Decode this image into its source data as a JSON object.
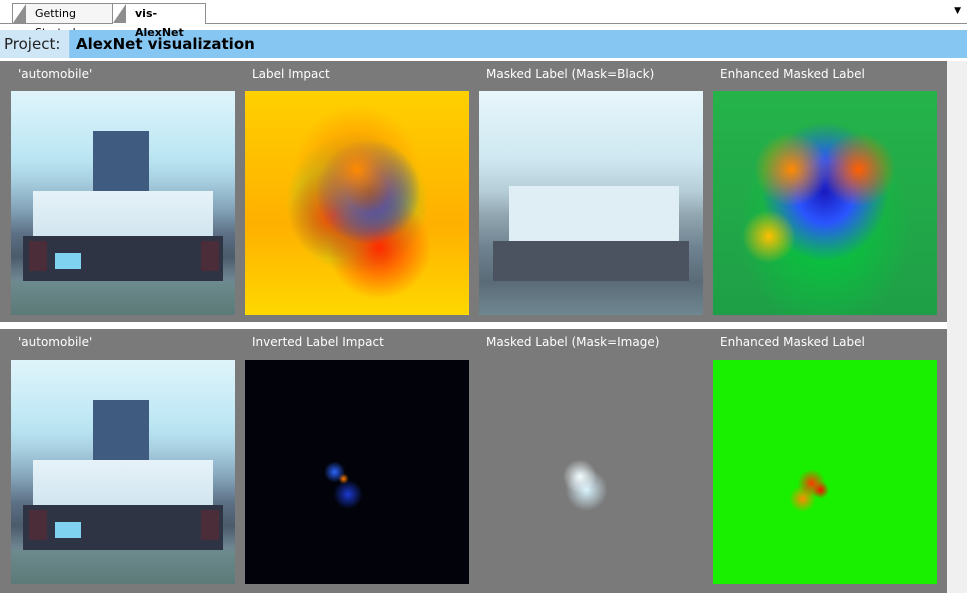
{
  "tabs": [
    {
      "label": "Getting Started"
    },
    {
      "label": "vis-AlexNet"
    }
  ],
  "project": {
    "label": "Project:",
    "name": "AlexNet visualization"
  },
  "rows": [
    {
      "cells": [
        {
          "label": "'automobile'"
        },
        {
          "label": "Label Impact"
        },
        {
          "label": "Masked Label (Mask=Black)"
        },
        {
          "label": "Enhanced Masked Label"
        }
      ]
    },
    {
      "cells": [
        {
          "label": "'automobile'"
        },
        {
          "label": "Inverted Label Impact"
        },
        {
          "label": "Masked Label (Mask=Image)"
        },
        {
          "label": "Enhanced Masked Label"
        }
      ]
    }
  ],
  "icons": {
    "tab_scroll": "chevron-down-icon"
  },
  "colors": {
    "header_bar": "#86c6f2",
    "panel_bg": "#7a7a7a"
  }
}
